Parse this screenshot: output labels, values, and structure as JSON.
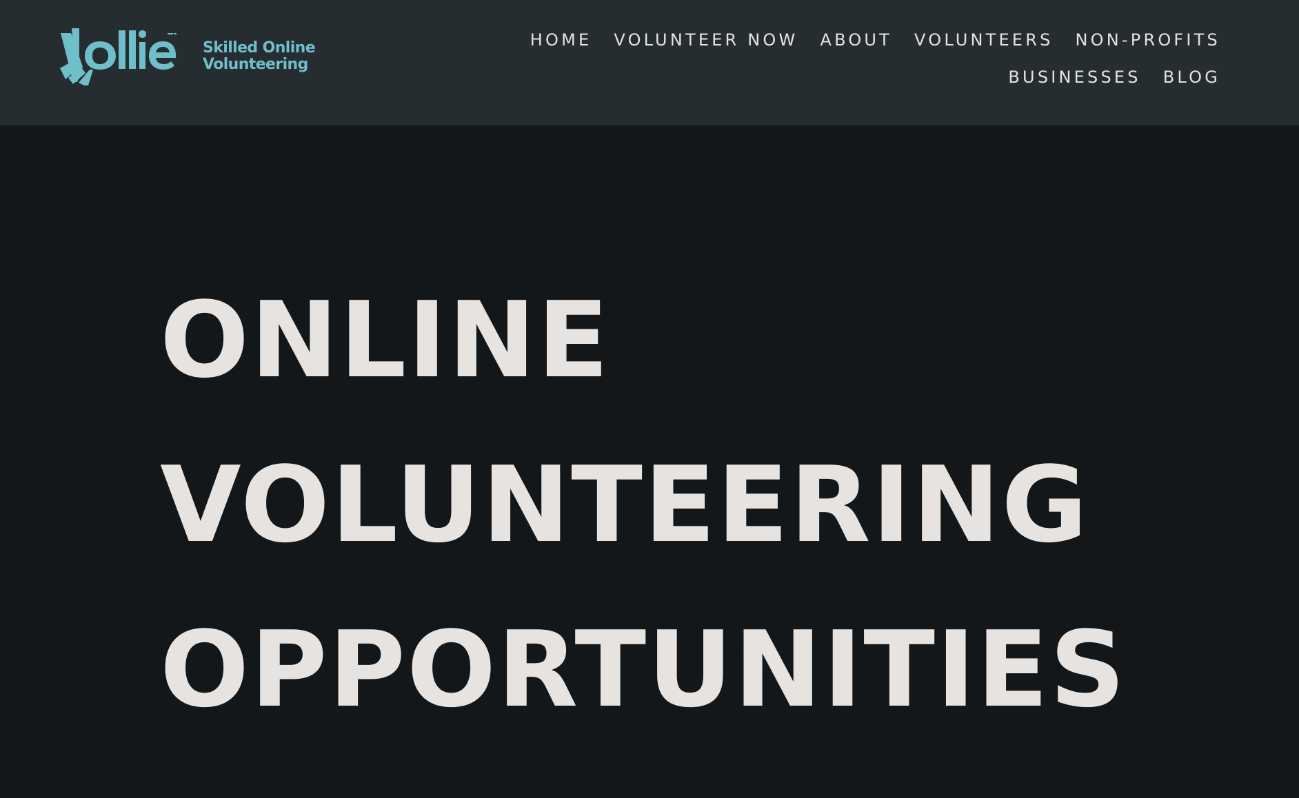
{
  "brand": {
    "logo_text": "Vollie",
    "tagline_line1": "Skilled Online",
    "tagline_line2": "Volunteering"
  },
  "nav": {
    "row1": [
      {
        "label": "HOME"
      },
      {
        "label": "VOLUNTEER NOW"
      },
      {
        "label": "ABOUT"
      },
      {
        "label": "VOLUNTEERS"
      },
      {
        "label": "NON-PROFITS"
      }
    ],
    "row2": [
      {
        "label": "BUSINESSES"
      },
      {
        "label": "BLOG"
      }
    ]
  },
  "hero": {
    "line1": "ONLINE",
    "line2": "VOLUNTEERING",
    "line3": "OPPORTUNITIES"
  },
  "colors": {
    "header_bg": "#262d31",
    "page_bg": "#131719",
    "brand_teal": "#6fbfca",
    "text_light": "#e6e2df"
  },
  "icons": {
    "logo": "vollie-logo-icon"
  }
}
